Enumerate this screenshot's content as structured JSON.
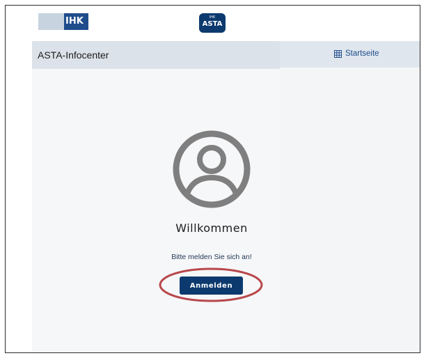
{
  "logos": {
    "ihk_text": "IHK",
    "asta_small": "IHK",
    "asta_big": "ASTA"
  },
  "header": {
    "title": "ASTA-Infocenter",
    "home_link": "Startseite",
    "home_icon": "grid-icon"
  },
  "main": {
    "avatar_icon": "user-circle-icon",
    "welcome": "Willkommen",
    "prompt": "Bitte melden Sie sich an!",
    "login_label": "Anmelden"
  },
  "colors": {
    "brand_dark": "#0d3a6e",
    "brand_blue": "#1f4d8c",
    "header_bg": "#dbe2e9",
    "annotation": "#b8474a",
    "avatar_gray": "#7f7f7f"
  }
}
